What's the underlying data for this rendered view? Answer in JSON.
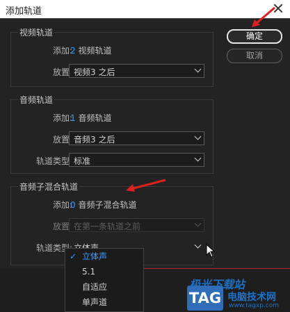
{
  "window": {
    "title": "添加轨道"
  },
  "buttons": {
    "ok": "确定",
    "cancel": "取消"
  },
  "video": {
    "group_title": "视频轨道",
    "add_label": "添加:",
    "add_count": "2",
    "add_unit": "视频轨道",
    "place_label": "放置:",
    "place_value": "视频3 之后"
  },
  "audio": {
    "group_title": "音频轨道",
    "add_label": "添加:",
    "add_count": "1",
    "add_unit": "音频轨道",
    "place_label": "放置:",
    "place_value": "音频3 之后",
    "type_label": "轨道类型:",
    "type_value": "标准"
  },
  "submix": {
    "group_title": "音频子混合轨道",
    "add_label": "添加:",
    "add_count": "0",
    "add_unit": "音频子混合轨道",
    "place_label": "放置:",
    "place_value": "在第一条轨道之前",
    "type_label": "轨道类型:",
    "type_value": "立体声"
  },
  "dropdown": {
    "check": "✓",
    "options": [
      "立体声",
      "5.1",
      "自适应",
      "单声道"
    ],
    "selected": "立体声"
  },
  "watermark": {
    "line1": "极光下载站",
    "tag": "TAG",
    "line2": "电脑技术网",
    "url": "www.tagxp.com"
  },
  "colors": {
    "accent": "#3e9bff",
    "annotation": "#e02020"
  }
}
